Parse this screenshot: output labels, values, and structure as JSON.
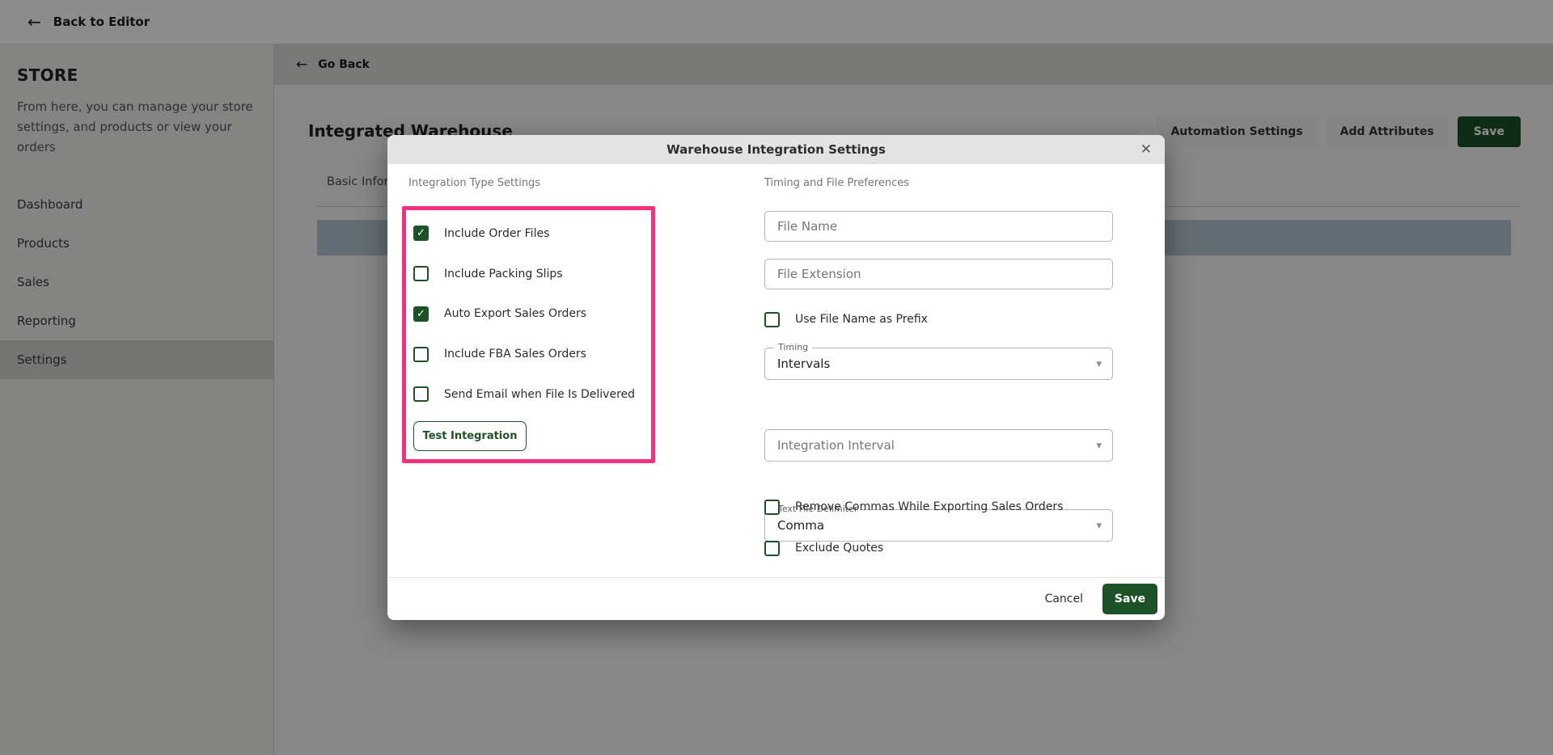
{
  "topbar": {
    "back_label": "Back to Editor",
    "back_icon": "←"
  },
  "sidebar": {
    "title": "STORE",
    "description": "From here, you can manage your store settings, and products or view your orders",
    "items": [
      {
        "label": "Dashboard",
        "selected": false
      },
      {
        "label": "Products",
        "selected": false
      },
      {
        "label": "Sales",
        "selected": false
      },
      {
        "label": "Reporting",
        "selected": false
      },
      {
        "label": "Settings",
        "selected": true
      }
    ]
  },
  "main": {
    "go_back_label": "Go Back",
    "go_back_icon": "←",
    "page_title": "Integrated Warehouse",
    "actions": {
      "automation_settings": "Automation Settings",
      "add_attributes": "Add Attributes",
      "save": "Save"
    },
    "tab_label": "Basic Information"
  },
  "modal": {
    "title": "Warehouse Integration Settings",
    "close_icon": "✕",
    "left": {
      "section_label": "Integration Type Settings",
      "checkboxes": [
        {
          "label": "Include Order Files",
          "checked": true
        },
        {
          "label": "Include Packing Slips",
          "checked": false
        },
        {
          "label": "Auto Export Sales Orders",
          "checked": true
        },
        {
          "label": "Include FBA Sales Orders",
          "checked": false
        },
        {
          "label": "Send Email when File Is Delivered",
          "checked": false
        }
      ],
      "test_button_label": "Test Integration"
    },
    "right": {
      "section_label": "Timing and File Preferences",
      "file_name_placeholder": "File Name",
      "file_extension_placeholder": "File Extension",
      "prefix_checkbox": {
        "label": "Use File Name as Prefix",
        "checked": false
      },
      "timing_select": {
        "label": "Timing",
        "value": "Intervals"
      },
      "interval_select": {
        "placeholder": "Integration Interval"
      },
      "delimiter_select": {
        "label": "Text File Delimiter",
        "value": "Comma"
      },
      "remove_commas_checkbox": {
        "label": "Remove Commas While Exporting Sales Orders",
        "checked": false
      },
      "exclude_quotes_checkbox": {
        "label": "Exclude Quotes",
        "checked": false
      },
      "caret_icon": "▾"
    },
    "footer": {
      "cancel_label": "Cancel",
      "save_label": "Save"
    }
  },
  "colors": {
    "accent_green": "#1d5228",
    "highlight_pink": "#f5317f",
    "slate_bar": "#b7c6d1"
  }
}
